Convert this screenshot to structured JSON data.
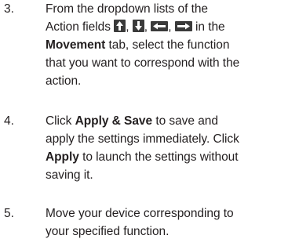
{
  "steps": [
    {
      "number": "3.",
      "lines": [
        "From the dropdown lists of the",
        "Action fields",
        "in the",
        "Movement",
        "tab, select the function",
        "that you want to correspond with the",
        "action."
      ],
      "icons": [
        "arrow-up-icon",
        "arrow-down-icon",
        "arrow-left-icon",
        "arrow-right-icon"
      ]
    },
    {
      "number": "4.",
      "parts": {
        "a": "Click ",
        "b": "Apply & Save",
        "c": " to save and",
        "d": "apply the settings immediately. Click",
        "e": "Apply",
        "f": " to launch the settings without",
        "g": "saving it."
      }
    },
    {
      "number": "5.",
      "lines": [
        "Move your device corresponding to",
        "your specified function."
      ]
    }
  ],
  "colors": {
    "text": "#231f20",
    "icon_bg": "#3a3a3a",
    "icon_arrow": "#ffffff"
  }
}
